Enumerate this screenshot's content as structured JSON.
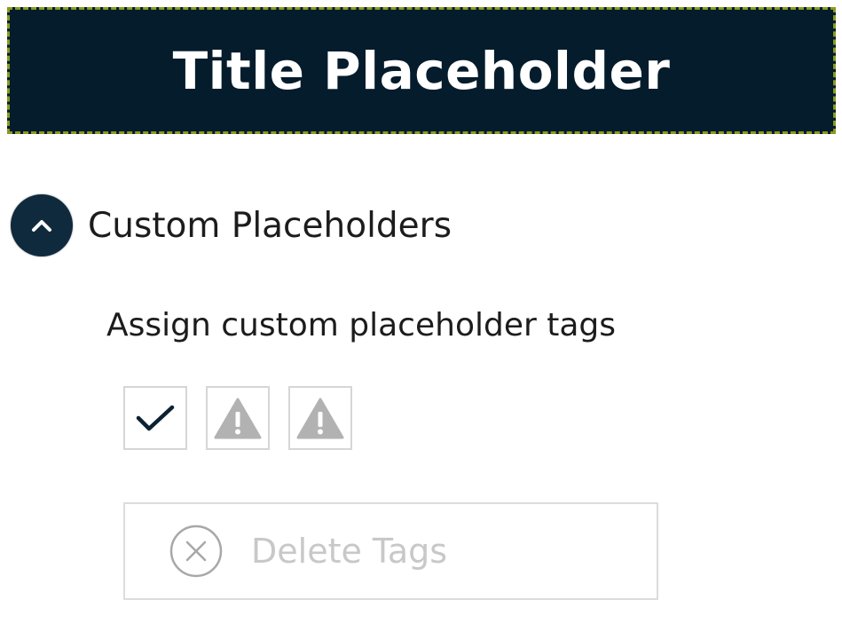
{
  "title_placeholder": {
    "text": "Title Placeholder",
    "background_color": "#051c2c",
    "border_color": "#8a9a20"
  },
  "custom_placeholders": {
    "section_label": "Custom Placeholders",
    "expanded": true,
    "toggle_icon": "chevron-up-icon",
    "assign_label": "Assign custom placeholder tags",
    "tags": [
      {
        "state": "checked",
        "icon": "checkmark-icon"
      },
      {
        "state": "warning",
        "icon": "warning-icon"
      },
      {
        "state": "warning",
        "icon": "warning-icon"
      }
    ],
    "delete_button": {
      "label": "Delete Tags",
      "icon": "circle-x-icon",
      "enabled": false
    }
  }
}
